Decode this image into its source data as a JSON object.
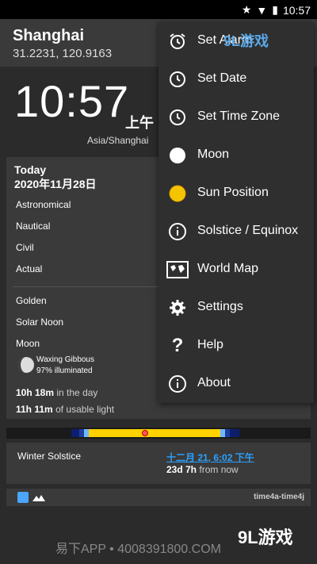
{
  "status": {
    "time": "10:57"
  },
  "header": {
    "city": "Shanghai",
    "coords": "31.2231, 120.9163"
  },
  "clock": {
    "time": "10:57",
    "ampm": "上午",
    "timezone": "Asia/Shanghai"
  },
  "card": {
    "today": "Today",
    "date": "2020年11月28日",
    "rows": [
      "Astronomical",
      "Nautical",
      "Civil",
      "Actual"
    ],
    "rows2": [
      "Golden",
      "Solar Noon",
      "Moon"
    ],
    "moon_phase": "Waxing Gibbous",
    "moon_illum": "97% illuminated",
    "day_len_a": "10h 18m",
    "day_len_b": "in the day",
    "light_a": "11h 11m",
    "light_b": "of usable light"
  },
  "solstice": {
    "title": "Winter Solstice",
    "date": "十二月 21, 6:02 下午",
    "until_a": "23d 7h",
    "until_b": "from now"
  },
  "bottom": {
    "tz": "time4a-time4j"
  },
  "watermark": "易下APP • 4008391800.COM",
  "logos": {
    "top": "9L游戏",
    "bottom": "9L游戏"
  },
  "menu": {
    "items": [
      {
        "label": "Set Alarm",
        "icon": "alarm-icon"
      },
      {
        "label": "Set Date",
        "icon": "clock-icon"
      },
      {
        "label": "Set Time Zone",
        "icon": "clock-icon"
      },
      {
        "label": "Moon",
        "icon": "moon-icon"
      },
      {
        "label": "Sun Position",
        "icon": "sun-icon"
      },
      {
        "label": "Solstice / Equinox",
        "icon": "info-icon"
      },
      {
        "label": "World Map",
        "icon": "map-icon"
      },
      {
        "label": "Settings",
        "icon": "gear-icon"
      },
      {
        "label": "Help",
        "icon": "help-icon"
      },
      {
        "label": "About",
        "icon": "info-icon"
      }
    ]
  },
  "colors": {
    "accent": "#2aa1ff",
    "sun": "#f5c400",
    "bar_day": "#ffd200",
    "bar_twilight": "#4aa6ff",
    "bar_night": "#0b1f6e"
  }
}
